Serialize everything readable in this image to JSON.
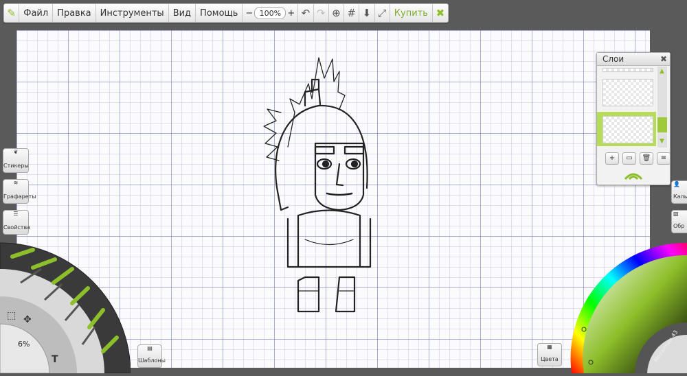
{
  "menu": {
    "items": [
      "Файл",
      "Правка",
      "Инструменты",
      "Вид",
      "Помощь"
    ],
    "zoom_minus": "−",
    "zoom_value": "100%",
    "zoom_plus": "+",
    "buy": "Купить"
  },
  "left_panel": {
    "stickers": "Стикеры",
    "stencils": "Графареты",
    "properties": "Свойства"
  },
  "tool_wheel": {
    "brush_size": "6%",
    "text_tool": "T"
  },
  "layers": {
    "title": "Слои",
    "close": "✖",
    "tools": [
      "+",
      "▭",
      "🗑",
      "≡"
    ]
  },
  "bottom": {
    "templates": "Шаблоны",
    "colors": "Цвета"
  },
  "right_panel": {
    "calibrate": "Каль",
    "ref": "Обр"
  },
  "color_wheel": {
    "metal_label": "Металлик 43"
  },
  "accent_color": "#8cbf2a"
}
